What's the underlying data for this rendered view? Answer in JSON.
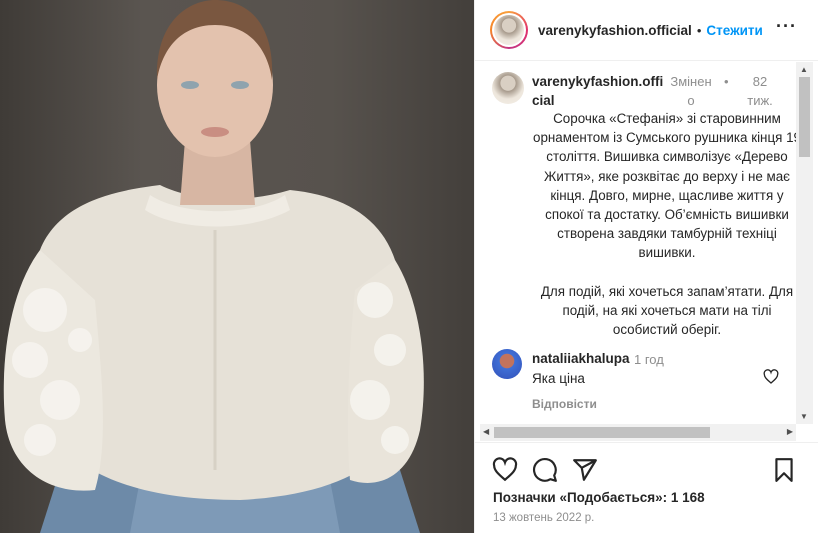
{
  "header": {
    "username": "varenykyfashion.official",
    "dot": "•",
    "follow_label": "Стежити",
    "more_label": "···"
  },
  "caption": {
    "username": "varenykyfashion.official",
    "edited": "Змінено",
    "dot": "•",
    "time": "82 тиж.",
    "paragraphs": [
      "Сорочка «Стефанія» зі старовинним орнаментом із Сумського рушника кінця 19 століття. Вишивка символізує «Дерево Життя», яке розквітає до верху і не має кінця. Довго, мирне, щасливе життя у спокої та достатку. Об’ємність вишивки створена завдяки тамбурній техніці вишивки.",
      "Для подій, які хочеться запам’ятати. Для подій, на які хочеться мати на тілі особистий оберіг."
    ]
  },
  "comment": {
    "username": "nataliiakhalupa",
    "time": "1 год",
    "text": "Яка ціна",
    "reply_label": "Відповісти"
  },
  "scrollbars": {
    "up": "▲",
    "down": "▼",
    "left": "◀",
    "right": "▶"
  },
  "actions": {
    "icons": [
      "heart-icon",
      "comment-icon",
      "share-icon",
      "bookmark-icon"
    ]
  },
  "likes_text": "Позначки «Подобається»: 1 168",
  "date_text": "13 жовтень 2022 р.",
  "colors": {
    "accent": "#0095f6",
    "text": "#262626",
    "muted": "#8e8e8e",
    "divider": "#efefef"
  }
}
